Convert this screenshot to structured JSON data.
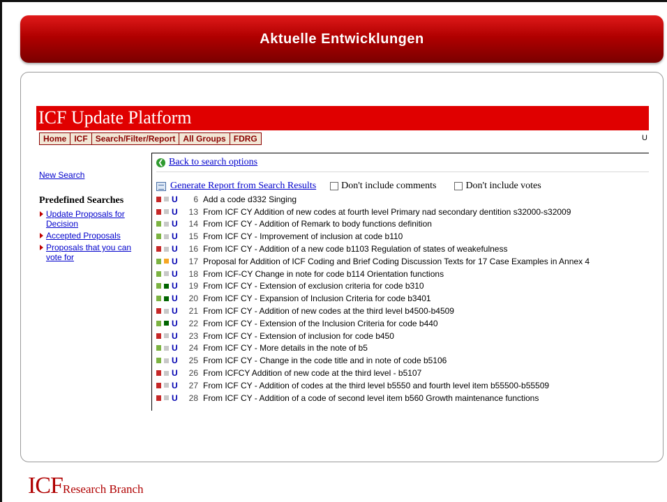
{
  "slide": {
    "banner_title": "Aktuelle Entwicklungen",
    "footer_logo_big": "ICF",
    "footer_logo_small": "Research Branch"
  },
  "platform": {
    "title": "ICF Update Platform",
    "nav": [
      "Home",
      "ICF",
      "Search/Filter/Report",
      "All Groups",
      "FDRG"
    ],
    "user_fragment": "U"
  },
  "sidebar": {
    "new_search": "New Search",
    "predefined_title": "Predefined Searches",
    "predefined": [
      "Update Proposals for Decision",
      "Accepted Proposals",
      "Proposals that you can vote for"
    ]
  },
  "main": {
    "back_link": "Back to search options",
    "report_link": "Generate Report from Search Results",
    "option_comments": "Don't include comments",
    "option_votes": "Don't include votes"
  },
  "colors": {
    "brand_red": "#e00000",
    "banner_red": "#b00000",
    "link_blue": "#0000cc",
    "status_red": "#c62828",
    "status_green": "#7cb342",
    "status_grey": "#c8c8c8",
    "status_dark_green": "#006400",
    "status_orange": "#f5a623"
  },
  "proposals": [
    {
      "num": "6",
      "title": "Add a code d332 Singing",
      "s1": "#c62828",
      "s2": "#c8c8c8"
    },
    {
      "num": "13",
      "title": "From ICF CY Addition of new codes at fourth level Primary nad secondary dentition s32000-s32009",
      "s1": "#c62828",
      "s2": "#c8c8c8"
    },
    {
      "num": "14",
      "title": "From ICF CY - Addition of Remark to body functions definition",
      "s1": "#7cb342",
      "s2": "#c8c8c8"
    },
    {
      "num": "15",
      "title": "From ICF CY - Improvement of inclusion at code b110",
      "s1": "#7cb342",
      "s2": "#c8c8c8"
    },
    {
      "num": "16",
      "title": "From ICF CY - Addition of a new code b1103 Regulation of states of weakefulness",
      "s1": "#c62828",
      "s2": "#c8c8c8"
    },
    {
      "num": "17",
      "title": "Proposal for Addition of ICF Coding and Brief Coding Discussion Texts for 17 Case Examples in Annex 4",
      "s1": "#7cb342",
      "s2": "#f5a623"
    },
    {
      "num": "18",
      "title": "From ICF-CY Change in note for code b114 Orientation functions",
      "s1": "#7cb342",
      "s2": "#c8c8c8"
    },
    {
      "num": "19",
      "title": "From ICF CY - Extension of exclusion criteria for code b310",
      "s1": "#7cb342",
      "s2": "#006400"
    },
    {
      "num": "20",
      "title": "From ICF CY - Expansion of Inclusion Criteria for code b3401",
      "s1": "#7cb342",
      "s2": "#006400"
    },
    {
      "num": "21",
      "title": "From ICF CY - Addition of new codes at the third level b4500-b4509",
      "s1": "#c62828",
      "s2": "#c8c8c8"
    },
    {
      "num": "22",
      "title": "From ICF CY - Extension of the Inclusion Criteria for code b440",
      "s1": "#7cb342",
      "s2": "#006400"
    },
    {
      "num": "23",
      "title": "From ICF CY - Extension of inclusion for code b450",
      "s1": "#c62828",
      "s2": "#c8c8c8"
    },
    {
      "num": "24",
      "title": "From ICF CY - More details in the note of b5",
      "s1": "#7cb342",
      "s2": "#c8c8c8"
    },
    {
      "num": "25",
      "title": "From ICF CY - Change in the code title and in note of code b5106",
      "s1": "#7cb342",
      "s2": "#c8c8c8"
    },
    {
      "num": "26",
      "title": "From ICFCY Addition of new code at the third level - b5107",
      "s1": "#c62828",
      "s2": "#c8c8c8"
    },
    {
      "num": "27",
      "title": "From ICF CY - Addition of codes at the third level b5550 and fourth level item b55500-b55509",
      "s1": "#c62828",
      "s2": "#c8c8c8"
    },
    {
      "num": "28",
      "title": "From ICF CY - Addition of a code of second level item b560 Growth maintenance functions",
      "s1": "#c62828",
      "s2": "#c8c8c8"
    }
  ],
  "row_button_label": "U"
}
